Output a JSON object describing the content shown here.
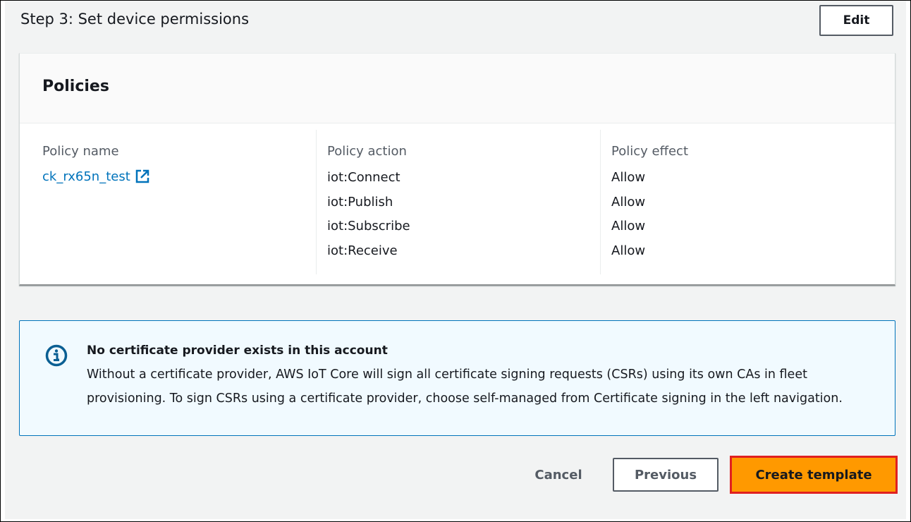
{
  "step": {
    "title": "Step 3: Set device permissions",
    "edit_label": "Edit"
  },
  "policies": {
    "header": "Policies",
    "columns": {
      "name_label": "Policy name",
      "action_label": "Policy action",
      "effect_label": "Policy effect"
    },
    "policy_name": "ck_rx65n_test",
    "actions": [
      "iot:Connect",
      "iot:Publish",
      "iot:Subscribe",
      "iot:Receive"
    ],
    "effects": [
      "Allow",
      "Allow",
      "Allow",
      "Allow"
    ]
  },
  "info": {
    "title": "No certificate provider exists in this account",
    "body": "Without a certificate provider, AWS IoT Core will sign all certificate signing requests (CSRs) using its own CAs in fleet provisioning. To sign CSRs using a certificate provider, choose self-managed from Certificate signing in the left navigation."
  },
  "footer": {
    "cancel_label": "Cancel",
    "previous_label": "Previous",
    "create_label": "Create template"
  },
  "colors": {
    "link": "#0073bb",
    "primary": "#ff9900",
    "highlight_border": "#e02020",
    "info_bg": "#f1faff"
  },
  "icons": {
    "external_link": "external-link-icon",
    "info": "info-icon"
  }
}
